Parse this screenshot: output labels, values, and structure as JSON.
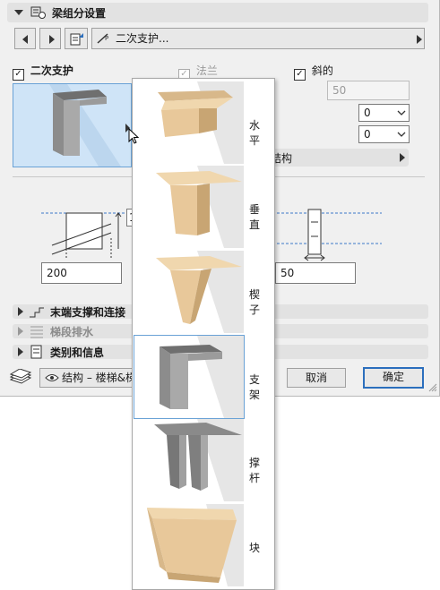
{
  "header": {
    "title": "梁组分设置"
  },
  "nav": {
    "component_name": "二次支护..."
  },
  "options": {
    "secondary_support": "二次支护",
    "flange": "法兰",
    "inclined": "斜的",
    "check_mark": "✓"
  },
  "fields": {
    "inclined_value": "50",
    "dropdown1": "0",
    "dropdown2": "0"
  },
  "structure_panel": {
    "label": "结构"
  },
  "dimensions": {
    "left_value": "200",
    "right_value": "50",
    "height_prefix": "1"
  },
  "sections": [
    {
      "label": "末端支撑和连接",
      "icon": "end-support-icon"
    },
    {
      "label": "梯段排水",
      "icon": "drainage-icon"
    },
    {
      "label": "类别和信息",
      "icon": "category-icon"
    }
  ],
  "footer": {
    "layer": "结构 – 楼梯&梯",
    "cancel": "取消",
    "ok": "确定"
  },
  "popup": {
    "items": [
      {
        "label": "水平",
        "icon": "horizontal-profile-icon"
      },
      {
        "label": "垂直",
        "icon": "vertical-profile-icon"
      },
      {
        "label": "楔子",
        "icon": "wedge-profile-icon"
      },
      {
        "label": "支架",
        "icon": "bracket-profile-icon",
        "selected": true
      },
      {
        "label": "撑杆",
        "icon": "strut-profile-icon"
      },
      {
        "label": "块",
        "icon": "block-profile-icon"
      }
    ]
  },
  "colors": {
    "accent": "#2c6fbd",
    "preview_bg": "#cfe4f7",
    "wood": "#e8c89a",
    "metal": "#8a8a8a"
  }
}
